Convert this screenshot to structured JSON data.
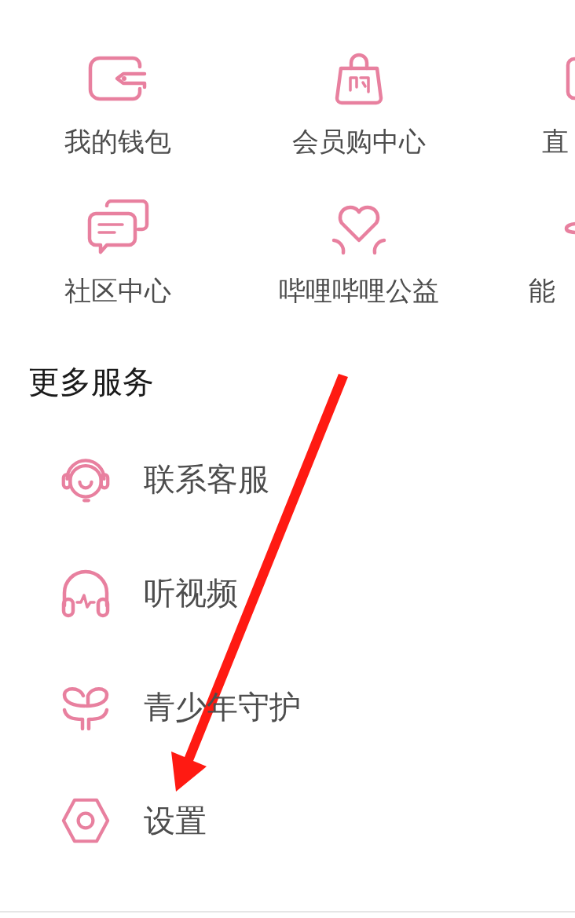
{
  "service_grid": [
    {
      "label": "我的钱包"
    },
    {
      "label": "会员购中心"
    },
    {
      "label": "直"
    },
    {
      "label": "社区中心"
    },
    {
      "label": "哔哩哔哩公益"
    },
    {
      "label": "能"
    }
  ],
  "more_services": {
    "title": "更多服务",
    "items": [
      {
        "label": "联系客服"
      },
      {
        "label": "听视频"
      },
      {
        "label": "青少年守护"
      },
      {
        "label": "设置"
      }
    ]
  }
}
